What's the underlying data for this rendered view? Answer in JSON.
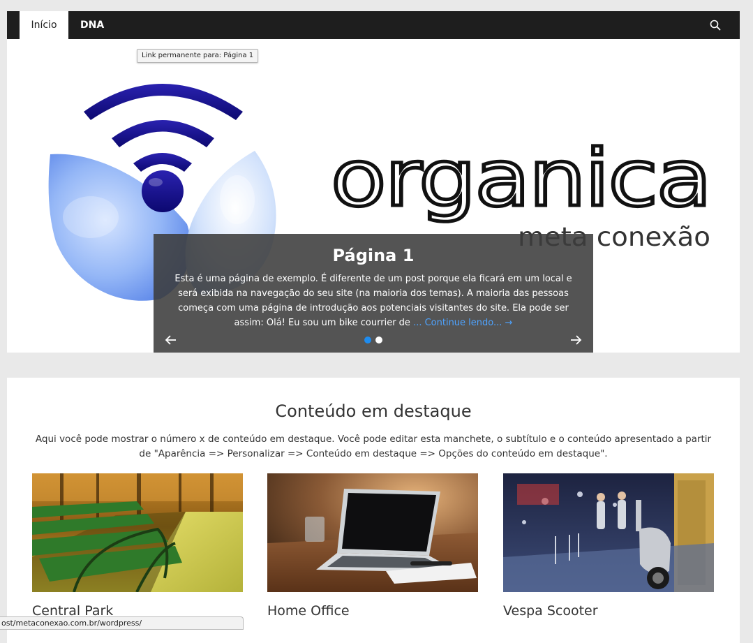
{
  "nav": {
    "items": [
      {
        "label": "Início",
        "active": true
      },
      {
        "label": "DNA",
        "active": false
      }
    ],
    "search_icon": "search-icon"
  },
  "slider": {
    "tooltip": "Link permanente para: Página 1",
    "logo": {
      "word": "organica",
      "tagline": "meta conexão"
    },
    "caption": {
      "title": "Página 1",
      "text": "Esta é uma página de exemplo. É diferente de um post porque ela ficará em um local e será exibida na navegação do seu site (na maioria dos temas). A maioria das pessoas começa com uma página de introdução aos potenciais visitantes do site. Ela pode ser assim: Olá! Eu sou um bike courrier de ",
      "link": "... Continue lendo... →"
    },
    "prev_icon": "arrow-left-icon",
    "next_icon": "arrow-right-icon",
    "dots": 2,
    "active_dot": 0,
    "colors": {
      "dot_active": "#1e8cf0",
      "dot_inactive": "#ffffff",
      "link": "#4ea3ff"
    }
  },
  "featured": {
    "title": "Conteúdo em destaque",
    "description": "Aqui você pode mostrar o número x de conteúdo em destaque. Você pode editar esta manchete, o subtítulo e o conteúdo apresentado a partir de \"Aparência => Personalizar => Conteúdo em destaque => Opções do conteúdo em destaque\".",
    "items": [
      {
        "title": "Central Park"
      },
      {
        "title": "Home Office"
      },
      {
        "title": "Vespa Scooter"
      }
    ]
  },
  "status_bar": {
    "url": "ost/metaconexao.com.br/wordpress/"
  },
  "colors": {
    "nav_bg": "#1e1e1e",
    "page_bg": "#e9e9e9",
    "logo_blue": "#140f8c"
  }
}
